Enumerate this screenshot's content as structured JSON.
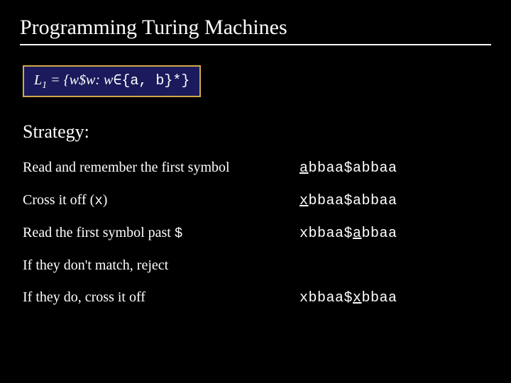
{
  "title": "Programming Turing Machines",
  "language_def": {
    "prefix": "L",
    "subscript": "1",
    "equals": " = {",
    "w1": "w",
    "dollar": "$",
    "w2": "w",
    "colon": ": ",
    "w3": "w",
    "member": "∈{a, b}*}",
    "plain": "L₁ = {w$w: w∈{a, b}*}"
  },
  "strategy_label": "Strategy:",
  "rows": [
    {
      "desc": "Read and remember the first symbol",
      "tape_pre": "",
      "tape_u": "a",
      "tape_post": "bbaa$abbaa"
    },
    {
      "desc": "Cross it off (x)",
      "tape_pre": "",
      "tape_u": "x",
      "tape_post": "bbaa$abbaa"
    },
    {
      "desc": "Read the first symbol past $",
      "tape_pre": "xbbaa$",
      "tape_u": "a",
      "tape_post": "bbaa"
    },
    {
      "desc": "If they don't match, reject",
      "tape_pre": "",
      "tape_u": "",
      "tape_post": ""
    },
    {
      "desc": "If they do, cross it off",
      "tape_pre": "xbbaa$",
      "tape_u": "x",
      "tape_post": "bbaa"
    }
  ]
}
